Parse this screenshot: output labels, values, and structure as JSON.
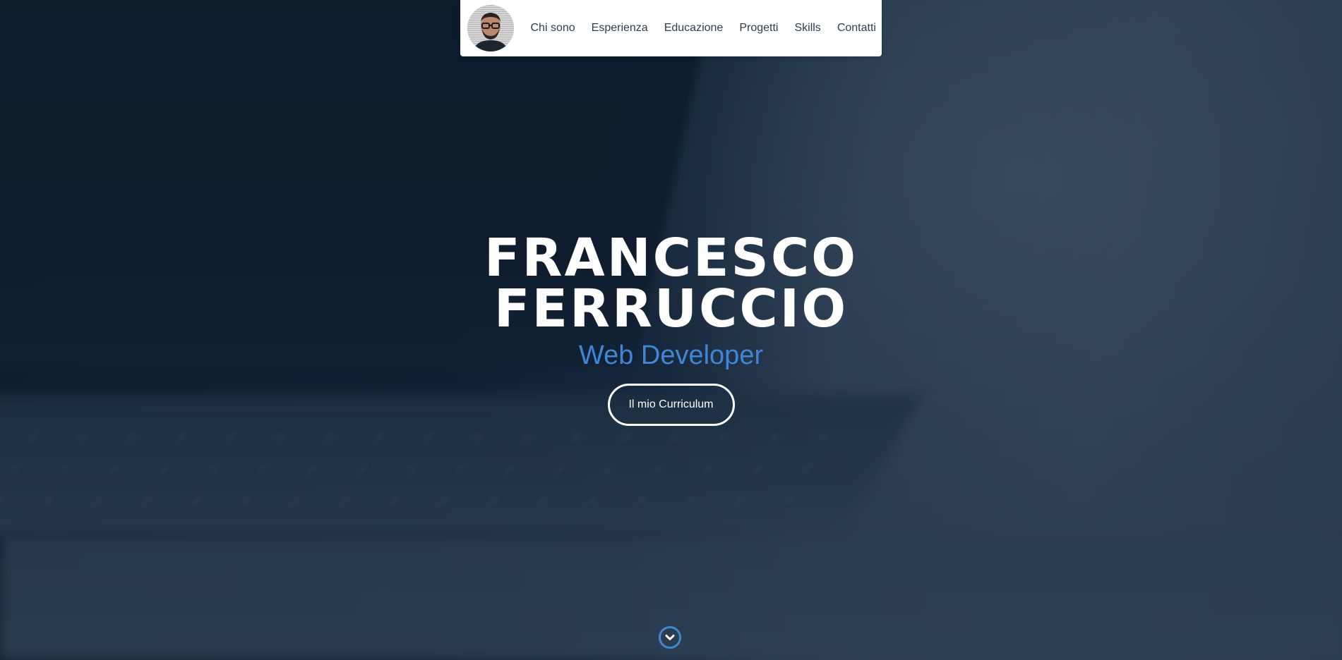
{
  "navbar": {
    "avatar_alt": "avatar",
    "links": [
      {
        "label": "Chi sono"
      },
      {
        "label": "Esperienza"
      },
      {
        "label": "Educazione"
      },
      {
        "label": "Progetti"
      },
      {
        "label": "Skills"
      },
      {
        "label": "Contatti"
      }
    ]
  },
  "hero": {
    "name_line1": "FRANCESCO",
    "name_line2": "FERRUCCIO",
    "role": "Web Developer",
    "cv_button_label": "Il mio Curriculum",
    "scroll_icon": "chevron-down-icon"
  },
  "colors": {
    "accent": "#3f87d6",
    "nav_text": "#2c3e50",
    "background_dark": "#0f1e2e"
  }
}
